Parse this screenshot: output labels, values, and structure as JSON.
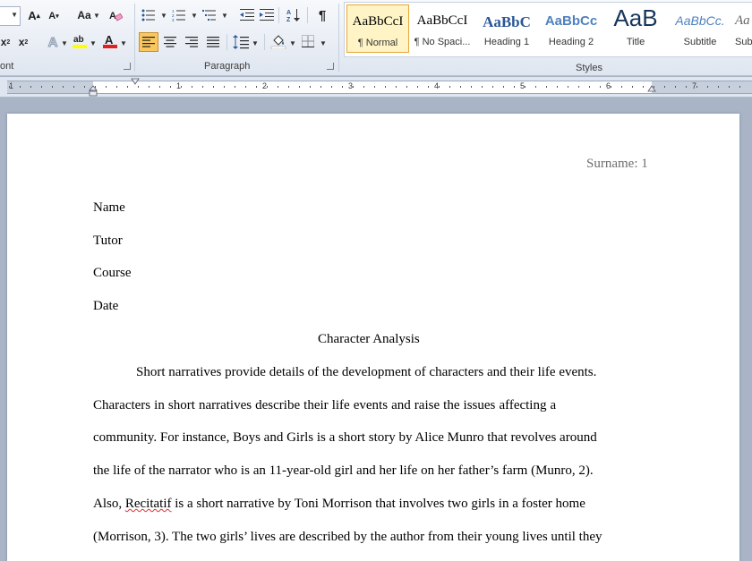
{
  "ribbon": {
    "font_group_label": "ont",
    "paragraph_group_label": "Paragraph",
    "styles_group_label": "Styles",
    "font_size_value": "",
    "change_case_label": "Aa",
    "styles": [
      {
        "preview": "AaBbCcI",
        "name": "¶ Normal"
      },
      {
        "preview": "AaBbCcI",
        "name": "¶ No Spaci..."
      },
      {
        "preview": "AaBbC",
        "name": "Heading 1"
      },
      {
        "preview": "AaBbCc",
        "name": "Heading 2"
      },
      {
        "preview": "AaB",
        "name": "Title"
      },
      {
        "preview": "AaBbCc.",
        "name": "Subtitle"
      },
      {
        "preview": "Aa",
        "name": "Sub"
      }
    ],
    "colors": {
      "highlight": "#ffff00",
      "font_color": "#e02020",
      "accent": "#2b579a"
    }
  },
  "ruler": {
    "numbers": [
      "1",
      "1",
      "2",
      "3",
      "4",
      "5",
      "6",
      "7"
    ]
  },
  "document": {
    "header": "Surname: 1",
    "lines": [
      "Name",
      "Tutor",
      "Course",
      "Date"
    ],
    "title": "Character Analysis",
    "paragraph": [
      "Short narratives provide details of the development of characters and their life events.",
      "Characters in short narratives describe their life events and raise the issues affecting a",
      "community. For instance, Boys and Girls is a short story by Alice Munro that revolves around",
      "the life of the narrator who is an 11-year-old girl and her life on her father’s farm (Munro, 2).",
      "Also,",
      "Recitatif",
      "is a short narrative by Toni Morrison that involves two girls in a foster home",
      "(Morrison, 3). The two girls’ lives are described by the author from their young lives until they"
    ]
  }
}
